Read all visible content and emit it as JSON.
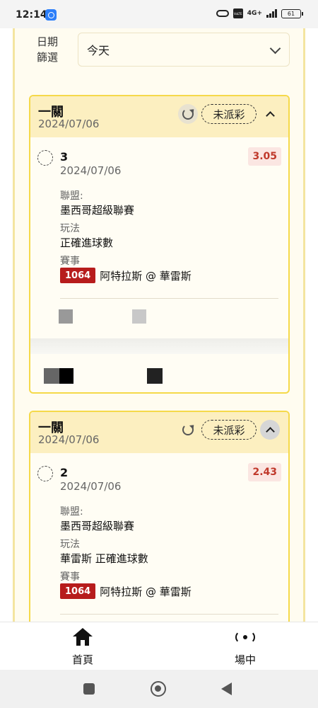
{
  "status_bar": {
    "time": "12:14",
    "volte": "VoLTE",
    "network": "4G+",
    "battery": "61"
  },
  "filter": {
    "label": "日期篩選",
    "selected": "今天"
  },
  "bets": [
    {
      "type": "一關",
      "date": "2024/07/06",
      "status": "未派彩",
      "selection": "3",
      "selection_date": "2024/07/06",
      "odds": "3.05",
      "league_label": "聯盟:",
      "league": "墨西哥超級聯賽",
      "market_label": "玩法",
      "market": "正確進球數",
      "event_label": "賽事",
      "match_code": "1064",
      "match": "阿特拉斯 @ 華雷斯"
    },
    {
      "type": "一關",
      "date": "2024/07/06",
      "status": "未派彩",
      "selection": "2",
      "selection_date": "2024/07/06",
      "odds": "2.43",
      "league_label": "聯盟:",
      "league": "墨西哥超級聯賽",
      "market_label": "玩法",
      "market": "華雷斯 正確進球數",
      "event_label": "賽事",
      "match_code": "1064",
      "match": "阿特拉斯 @ 華雷斯"
    }
  ],
  "bottom_nav": {
    "home": "首頁",
    "live": "場中"
  },
  "colors": {
    "accent_yellow": "#f5d94a",
    "header_bg": "#fcefc0",
    "odds_red": "#c0392b",
    "match_code_bg": "#b71c1c"
  },
  "icons": [
    "link-icon",
    "refresh-icon",
    "chevron-up-icon",
    "chevron-down-icon",
    "home-icon",
    "live-broadcast-icon"
  ]
}
